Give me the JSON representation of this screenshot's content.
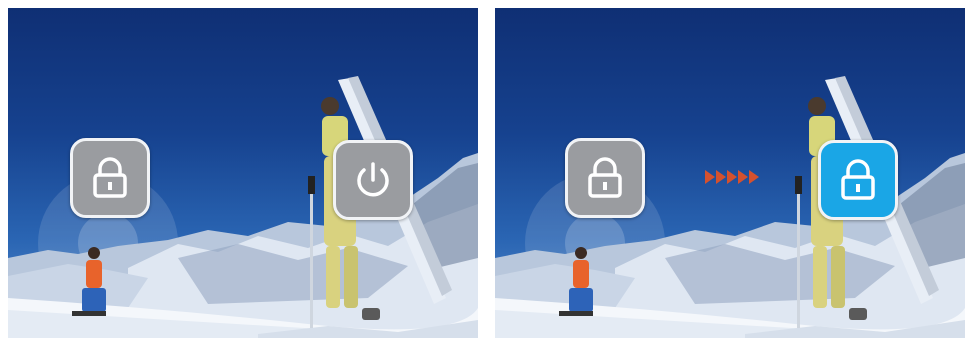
{
  "panels": [
    {
      "id": "before",
      "buttons": [
        {
          "icon": "lock-icon",
          "state": "inactive",
          "color": "#9a9ca0"
        },
        {
          "icon": "power-icon",
          "state": "inactive",
          "color": "#9a9ca0"
        }
      ]
    },
    {
      "id": "after",
      "buttons": [
        {
          "icon": "lock-icon",
          "state": "inactive",
          "color": "#9a9ca0"
        },
        {
          "icon": "lock-icon",
          "state": "active",
          "color": "#1aa6e6"
        }
      ],
      "transition_indicator": {
        "icon": "arrow-right-icon",
        "count": 5,
        "color": "#d5512e"
      }
    }
  ],
  "colors": {
    "button_gray": "#9a9ca0",
    "button_blue": "#1aa6e6",
    "button_border": "#f1f3f6",
    "arrow": "#d5512e"
  }
}
